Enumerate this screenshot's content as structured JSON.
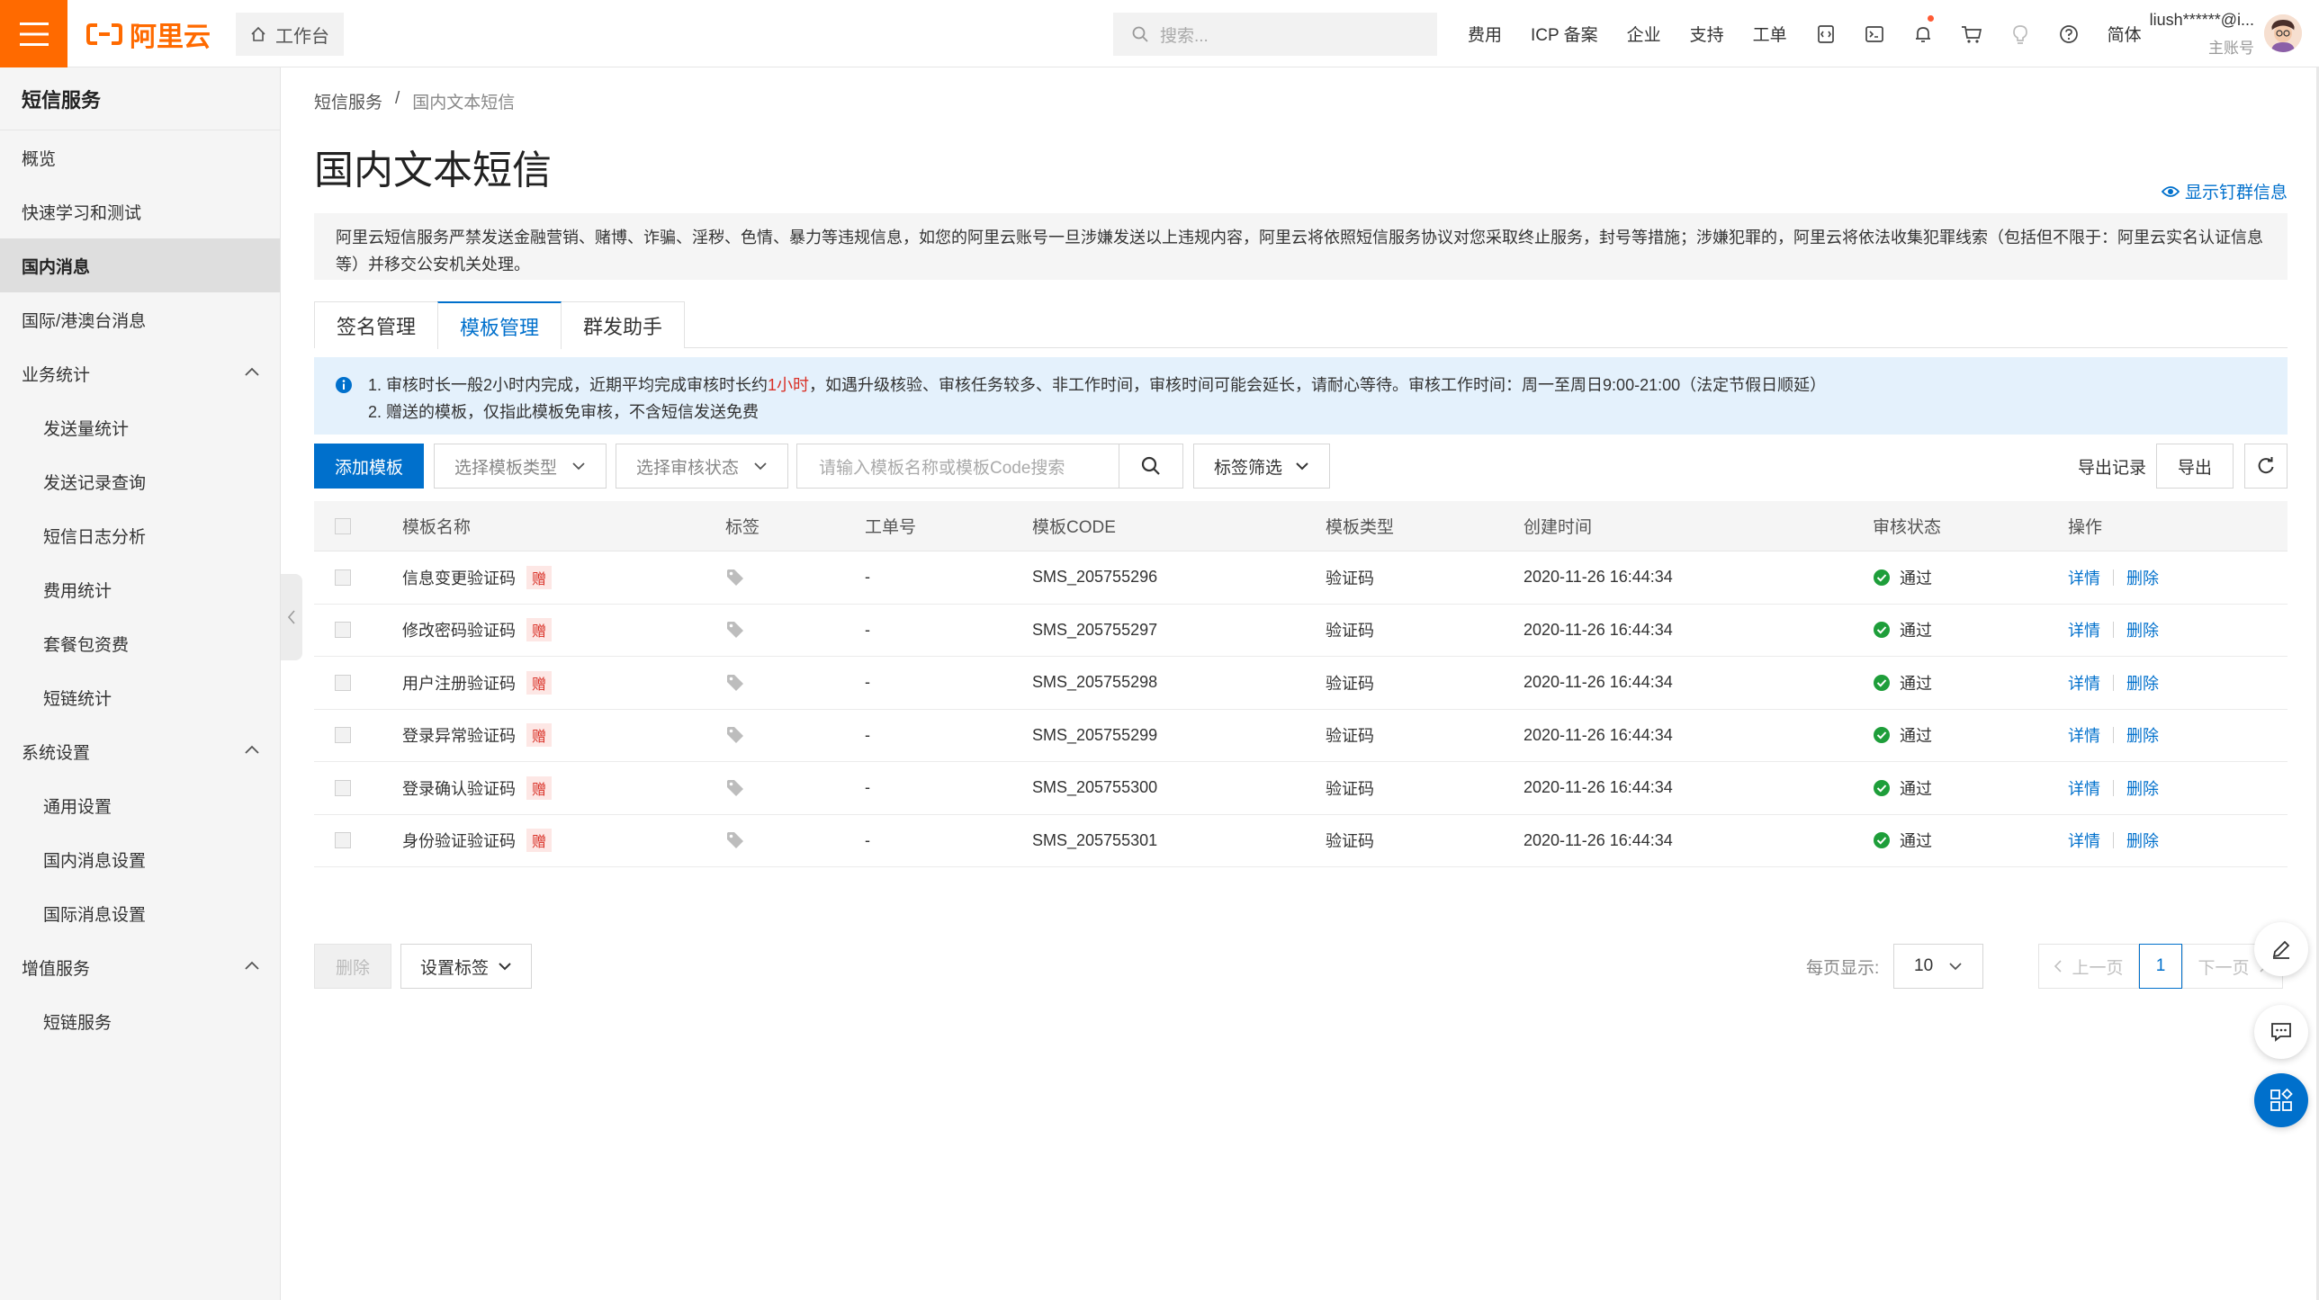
{
  "topbar": {
    "logo_text": "阿里云",
    "workbench_label": "工作台",
    "search_placeholder": "搜索...",
    "nav_links": [
      "费用",
      "ICP 备案",
      "企业",
      "支持",
      "工单"
    ],
    "lang_label": "简体",
    "account_name": "liush******@i...",
    "account_role": "主账号",
    "brand_color": "#ff6a00"
  },
  "sidebar": {
    "title": "短信服务",
    "items": [
      {
        "label": "概览"
      },
      {
        "label": "快速学习和测试"
      },
      {
        "label": "国内消息",
        "active": true
      },
      {
        "label": "国际/港澳台消息"
      },
      {
        "label": "业务统计",
        "group": true
      },
      {
        "label": "发送量统计",
        "sub": true
      },
      {
        "label": "发送记录查询",
        "sub": true
      },
      {
        "label": "短信日志分析",
        "sub": true
      },
      {
        "label": "费用统计",
        "sub": true
      },
      {
        "label": "套餐包资费",
        "sub": true
      },
      {
        "label": "短链统计",
        "sub": true
      },
      {
        "label": "系统设置",
        "group": true
      },
      {
        "label": "通用设置",
        "sub": true
      },
      {
        "label": "国内消息设置",
        "sub": true
      },
      {
        "label": "国际消息设置",
        "sub": true
      },
      {
        "label": "增值服务",
        "group": true
      },
      {
        "label": "短链服务",
        "sub": true
      }
    ]
  },
  "breadcrumb": {
    "root": "短信服务",
    "separator": "/",
    "current": "国内文本短信"
  },
  "page": {
    "title": "国内文本短信",
    "show_dingtalk": "显示钉群信息",
    "notice_line1": "阿里云短信服务严禁发送金融营销、赌博、诈骗、淫秽、色情、暴力等违规信息，如您的阿里云账号一旦涉嫌发送以上违规内容，阿里云将依照短信服务协议对您采取终止服务，封号等措施；涉嫌犯罪的，阿里云将依法收集犯罪线索（包括但不限于：阿里云实名认证信息",
    "notice_line2": "等）并移交公安机关处理。"
  },
  "tabs": [
    {
      "label": "签名管理"
    },
    {
      "label": "模板管理",
      "active": true
    },
    {
      "label": "群发助手"
    }
  ],
  "info": {
    "line1_before": "1. 审核时长一般2小时内完成，近期平均完成审核时长约",
    "line1_highlight": "1小时",
    "line1_after": "，如遇升级核验、审核任务较多、非工作时间，审核时间可能会延长，请耐心等待。审核工作时间：周一至周日9:00-21:00（法定节假日顺延）",
    "line2": "2. 赠送的模板，仅指此模板免审核，不含短信发送免费"
  },
  "toolbar": {
    "add_template": "添加模板",
    "template_type_placeholder": "选择模板类型",
    "review_status_placeholder": "选择审核状态",
    "search_placeholder": "请输入模板名称或模板Code搜索",
    "tag_filter": "标签筛选",
    "export_log": "导出记录",
    "export": "导出"
  },
  "table": {
    "headers": [
      "模板名称",
      "标签",
      "工单号",
      "模板CODE",
      "模板类型",
      "创建时间",
      "审核状态",
      "操作"
    ],
    "rows": [
      {
        "name": "信息变更验证码",
        "badge": "赠",
        "ticket": "-",
        "code": "SMS_205755296",
        "type": "验证码",
        "created": "2020-11-26 16:44:34",
        "status": "通过",
        "op_detail": "详情",
        "op_delete": "删除"
      },
      {
        "name": "修改密码验证码",
        "badge": "赠",
        "ticket": "-",
        "code": "SMS_205755297",
        "type": "验证码",
        "created": "2020-11-26 16:44:34",
        "status": "通过",
        "op_detail": "详情",
        "op_delete": "删除"
      },
      {
        "name": "用户注册验证码",
        "badge": "赠",
        "ticket": "-",
        "code": "SMS_205755298",
        "type": "验证码",
        "created": "2020-11-26 16:44:34",
        "status": "通过",
        "op_detail": "详情",
        "op_delete": "删除"
      },
      {
        "name": "登录异常验证码",
        "badge": "赠",
        "ticket": "-",
        "code": "SMS_205755299",
        "type": "验证码",
        "created": "2020-11-26 16:44:34",
        "status": "通过",
        "op_detail": "详情",
        "op_delete": "删除"
      },
      {
        "name": "登录确认验证码",
        "badge": "赠",
        "ticket": "-",
        "code": "SMS_205755300",
        "type": "验证码",
        "created": "2020-11-26 16:44:34",
        "status": "通过",
        "op_detail": "详情",
        "op_delete": "删除"
      },
      {
        "name": "身份验证验证码",
        "badge": "赠",
        "ticket": "-",
        "code": "SMS_205755301",
        "type": "验证码",
        "created": "2020-11-26 16:44:34",
        "status": "通过",
        "op_detail": "详情",
        "op_delete": "删除"
      }
    ]
  },
  "footer": {
    "delete_label": "删除",
    "set_tag_label": "设置标签",
    "per_page_label": "每页显示:",
    "per_page_value": "10",
    "prev_label": "上一页",
    "current_page": "1",
    "next_label": "下一页"
  },
  "colors": {
    "primary": "#0070cc",
    "success": "#1e9e3a",
    "danger": "#d93026"
  }
}
